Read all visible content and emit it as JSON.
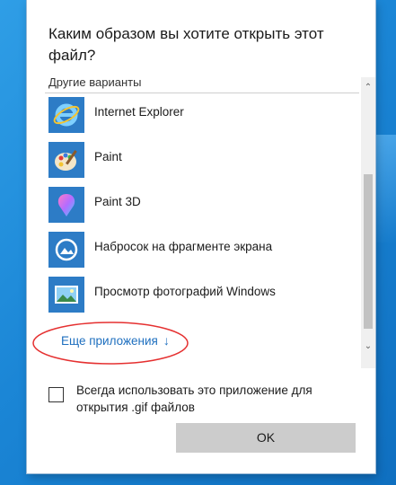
{
  "dialog": {
    "title": "Каким образом вы хотите открыть этот файл?",
    "section_label": "Другие варианты"
  },
  "apps": [
    {
      "label": "Internet Explorer",
      "icon": "internet-explorer-icon"
    },
    {
      "label": "Paint",
      "icon": "paint-icon"
    },
    {
      "label": "Paint 3D",
      "icon": "paint-3d-icon"
    },
    {
      "label": "Набросок на фрагменте экрана",
      "icon": "snip-sketch-icon"
    },
    {
      "label": "Просмотр фотографий Windows",
      "icon": "photo-viewer-icon"
    }
  ],
  "more_apps": {
    "label": "Еще приложения",
    "arrow": "↓"
  },
  "checkbox": {
    "label": "Всегда использовать это приложение для открытия .gif файлов",
    "checked": false
  },
  "ok_button": {
    "label": "OK"
  },
  "colors": {
    "accent": "#2d7cc6",
    "link": "#1e6fbf",
    "highlight_ellipse": "#e53030"
  }
}
